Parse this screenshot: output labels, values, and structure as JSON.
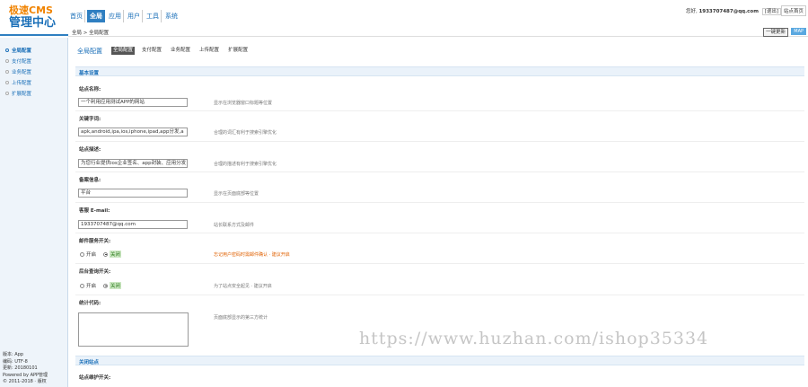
{
  "header": {
    "logo_top": "极速CMS",
    "logo_bottom": "管理中心",
    "nav": [
      {
        "label": "首页",
        "active": false
      },
      {
        "label": "全局",
        "active": true
      },
      {
        "label": "应用",
        "active": false
      },
      {
        "label": "用户",
        "active": false
      },
      {
        "label": "工具",
        "active": false
      },
      {
        "label": "系统",
        "active": false
      }
    ],
    "user_prefix": "您好,",
    "user_name": "1933707487@qq.com",
    "logout": "[退出]",
    "site_home": "站点首页"
  },
  "breadcrumb": "全局 > 全局配置",
  "toolbar": {
    "update_label": "一键更新",
    "map_label": "MAP"
  },
  "sidebar": {
    "items": [
      "全局配置",
      "支付配置",
      "业务配置",
      "上传配置",
      "扩展配置"
    ],
    "footer": [
      "版本: App",
      "编码: UTF-8",
      "更新: 20180101",
      "Powered by APP管理",
      "© 2011-2018 · 版权"
    ]
  },
  "main": {
    "config_title": "全局配置",
    "subtabs": [
      "全局配置",
      "支付配置",
      "业务配置",
      "上传配置",
      "扩展配置"
    ],
    "section_basic": "基本设置",
    "section_close": "关闭站点",
    "fields": {
      "site_name": {
        "label": "站点名称:",
        "value": "一个利用应用测试APP的网站",
        "hint": "显示在浏览器窗口标题等位置"
      },
      "keywords": {
        "label": "关键字词:",
        "value": "apk,android,ipa,ios,iphone,ipad,app分发,a",
        "hint": "合理的词汇有利于搜索引擎优化"
      },
      "description": {
        "label": "站点描述:",
        "value": "为您行业提供ios企业签名、app封装、应用分发",
        "hint": "合理的描述有利于搜索引擎优化"
      },
      "icp": {
        "label": "备案信息:",
        "value": "平台",
        "hint": "显示在页面底部等位置"
      },
      "email": {
        "label": "客服 E-mail:",
        "value": "1933707487@qq.com",
        "hint": "站长联系方式及邮件"
      },
      "mail_switch": {
        "label": "邮件服务开关:",
        "on": "开启",
        "off": "关闭",
        "hint": "忘记用户密码时需邮件确认 · 建议开启"
      },
      "query_switch": {
        "label": "后台查询开关:",
        "on": "开启",
        "off": "关闭",
        "hint": "为了站点安全起见 · 建议开启"
      },
      "stats_code": {
        "label": "统计代码:",
        "hint": "页面底部显示的第三方统计"
      },
      "maintenance": {
        "label": "站点维护开关:"
      }
    }
  },
  "watermark": "https://www.huzhan.com/ishop35334",
  "colors": {
    "brand_blue": "#2f7fc1",
    "logo_orange": "#f08300",
    "warn_orange": "#e06000"
  }
}
